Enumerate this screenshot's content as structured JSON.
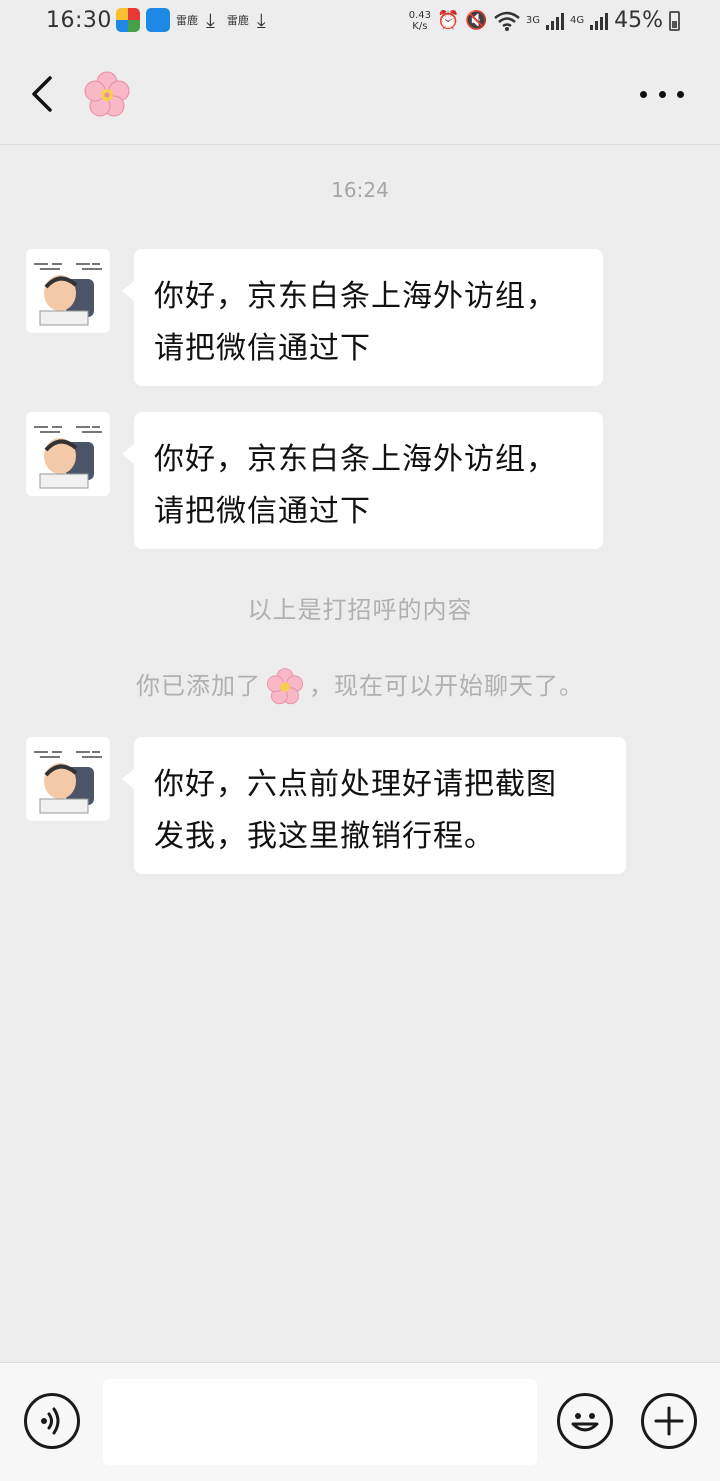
{
  "status_bar": {
    "time": "16:30",
    "app_labels": [
      "雷鹿",
      "雷鹿"
    ],
    "net_speed_value": "0.43",
    "net_speed_unit": "K/s",
    "network_1": "3G",
    "network_2": "4G",
    "battery_percent": "45%"
  },
  "header": {
    "back_icon": "chevron-left-icon",
    "contact_avatar": "cherry-blossom-icon",
    "more_icon": "more-dots-icon"
  },
  "chat": {
    "timestamp": "16:24",
    "messages": [
      {
        "sender": "contact",
        "lines": [
          "你好，京东白条上海外访组，",
          "请把微信通过下"
        ]
      },
      {
        "sender": "contact",
        "lines": [
          "你好，京东白条上海外访组，",
          "请把微信通过下"
        ]
      },
      {
        "sender": "contact",
        "lines": [
          "你好，六点前处理好请把截图",
          "发我，我这里撤销行程。"
        ]
      }
    ],
    "system_note_1": "以上是打招呼的内容",
    "system_note_2_prefix": "你已添加了",
    "system_note_2_suffix": "，现在可以开始聊天了。"
  },
  "input_bar": {
    "voice_icon": "voice-icon",
    "input_value": "",
    "emoji_icon": "emoji-icon",
    "plus_icon": "plus-icon"
  }
}
